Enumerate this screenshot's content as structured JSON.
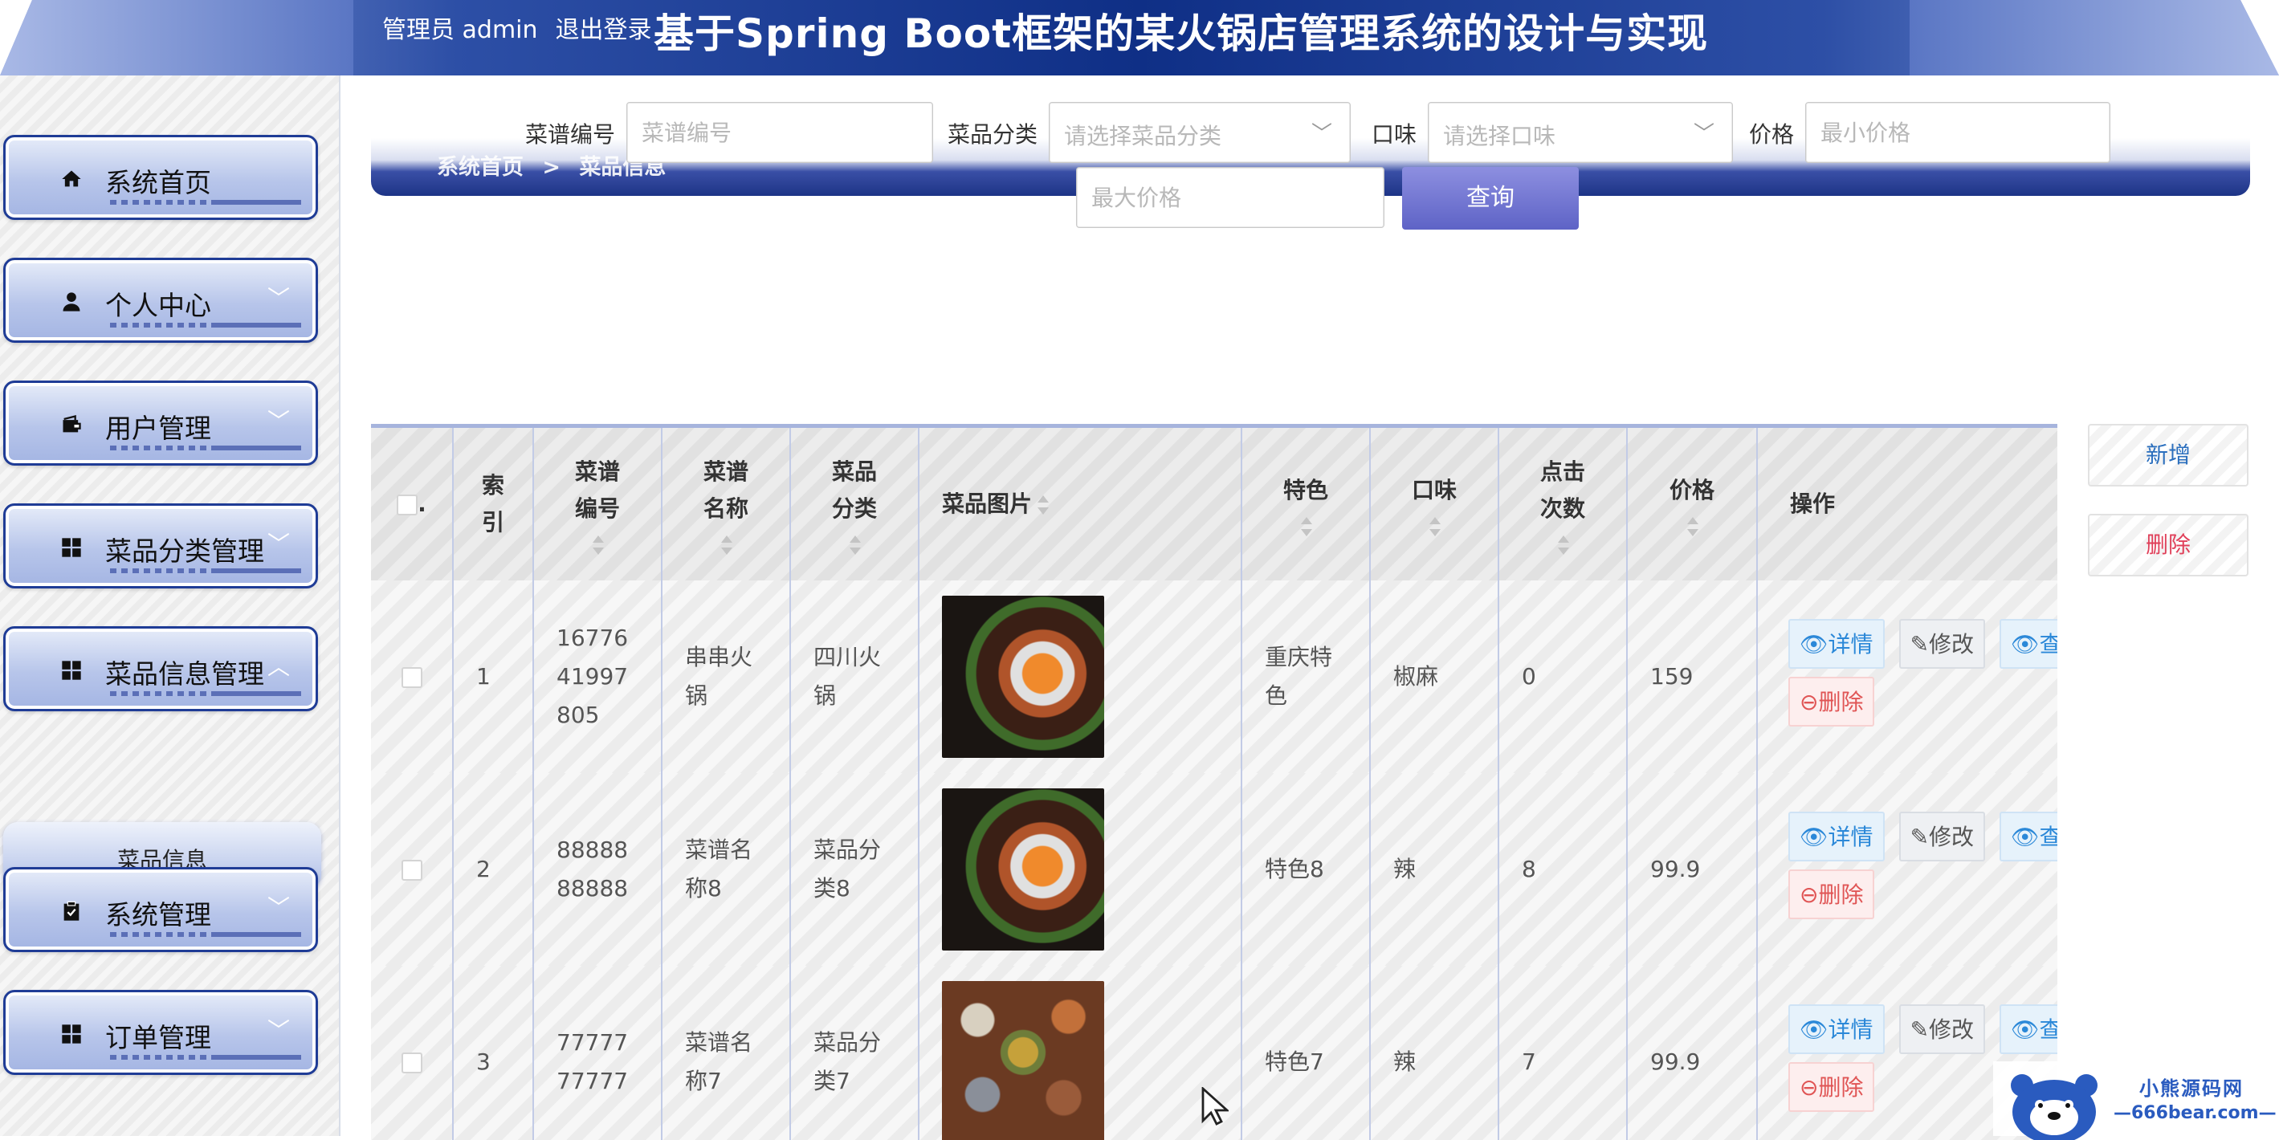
{
  "header": {
    "admin_text": "管理员 admin",
    "logout": "退出登录",
    "title": "基于Spring Boot框架的某火锅店管理系统的设计与实现"
  },
  "sidebar": {
    "items": [
      {
        "label": "系统首页",
        "icon": "home-icon"
      },
      {
        "label": "个人中心",
        "icon": "user-icon",
        "arrow": "﹀"
      },
      {
        "label": "用户管理",
        "icon": "wallet-icon",
        "arrow": "﹀"
      },
      {
        "label": "菜品分类管理",
        "icon": "grid-icon",
        "arrow": "﹀"
      },
      {
        "label": "菜品信息管理",
        "icon": "grid-icon",
        "arrow": "︿"
      },
      {
        "label": "系统管理",
        "icon": "clipboard-icon",
        "arrow": "﹀"
      },
      {
        "label": "订单管理",
        "icon": "grid-icon",
        "arrow": "﹀"
      }
    ],
    "submenu": "菜品信息"
  },
  "breadcrumb": {
    "home": "系统首页",
    "sep": ">",
    "current": "菜品信息"
  },
  "search": {
    "code_label": "菜谱编号",
    "code_placeholder": "菜谱编号",
    "category_label": "菜品分类",
    "category_placeholder": "请选择菜品分类",
    "taste_label": "口味",
    "taste_placeholder": "请选择口味",
    "price_label": "价格",
    "min_price_placeholder": "最小价格",
    "max_price_placeholder": "最大价格",
    "query_button": "查询"
  },
  "actions": {
    "add": "新增",
    "delete": "删除"
  },
  "table": {
    "headers": {
      "index": "索引",
      "code": "菜谱编号",
      "name": "菜谱名称",
      "category": "菜品分类",
      "image": "菜品图片",
      "feature": "特色",
      "taste": "口味",
      "clicks": "点击次数",
      "price": "价格",
      "ops": "操作"
    },
    "rows": [
      {
        "index": "1",
        "code": "1677641997805",
        "name": "串串火锅",
        "category": "四川火锅",
        "image": "hotpot-photo",
        "feature": "重庆特色",
        "taste": "椒麻",
        "clicks": "0",
        "price": "159"
      },
      {
        "index": "2",
        "code": "8888888888",
        "name": "菜谱名称8",
        "category": "菜品分类8",
        "image": "hotpot-photo",
        "feature": "特色8",
        "taste": "辣",
        "clicks": "8",
        "price": "99.9"
      },
      {
        "index": "3",
        "code": "7777777777",
        "name": "菜谱名称7",
        "category": "菜品分类7",
        "image": "platter-photo",
        "feature": "特色7",
        "taste": "辣",
        "clicks": "7",
        "price": "99.9"
      }
    ],
    "op_labels": {
      "detail": "详情",
      "edit": "修改",
      "view": "查",
      "delete": "删除"
    }
  },
  "watermark": {
    "name": "小熊源码网",
    "url": "—666bear.com—"
  },
  "colors": {
    "header_dark": "#0f2f86",
    "menu_border": "#1f3c96",
    "query_button": "#5e63c6",
    "link_blue": "#2b88d8",
    "danger_red": "#e05555"
  }
}
